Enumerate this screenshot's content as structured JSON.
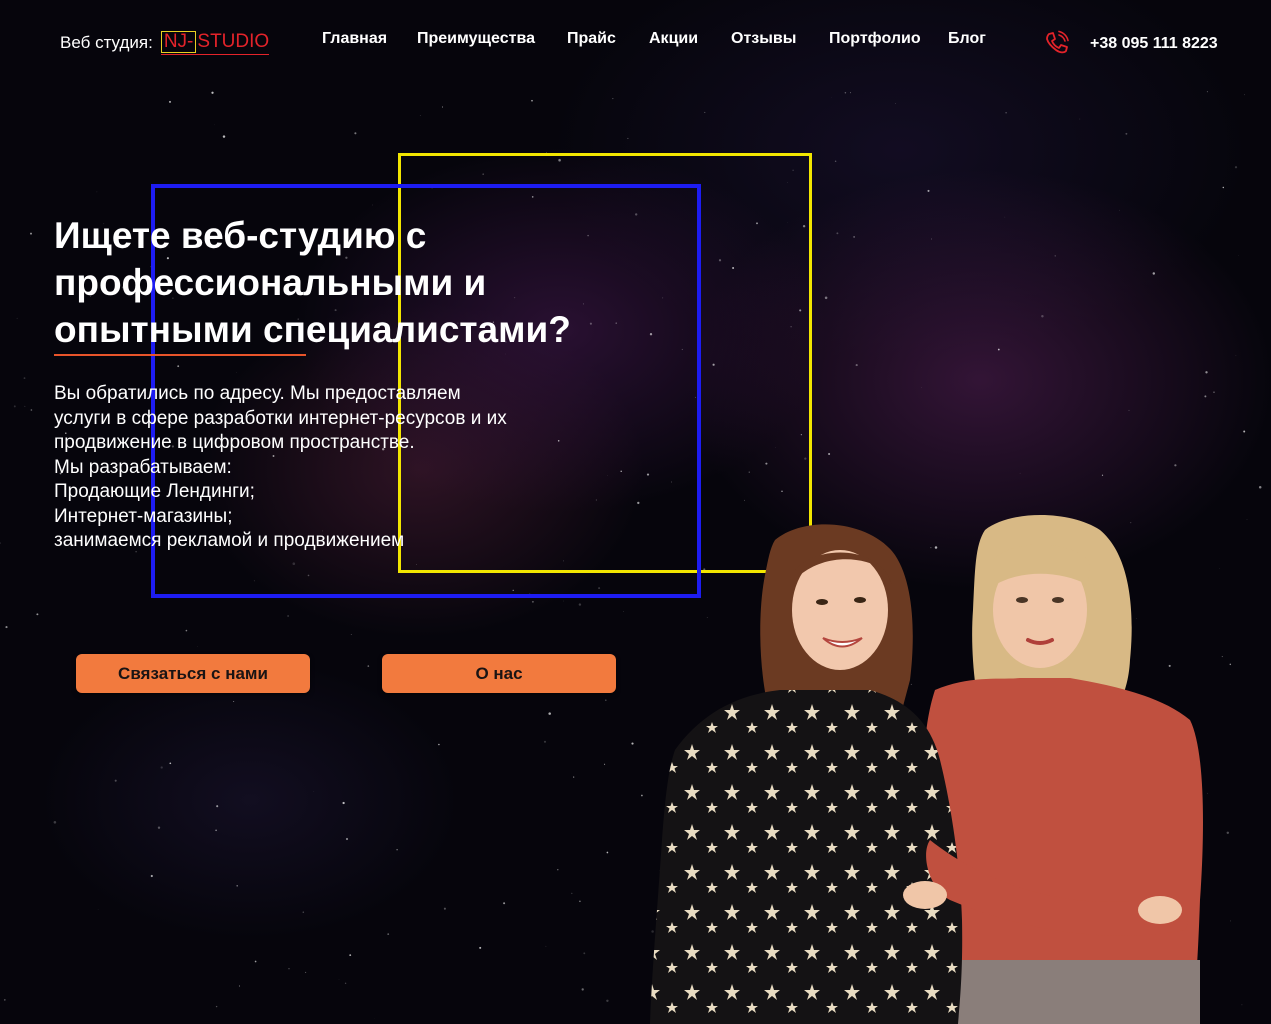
{
  "header": {
    "logo_prefix": "Веб студия:",
    "logo_nj": "NJ-",
    "logo_studio": "STUDIO",
    "nav": [
      {
        "label": "Главная"
      },
      {
        "label": "Преимущества"
      },
      {
        "label": "Прайс"
      },
      {
        "label": "Акции"
      },
      {
        "label": "Отзывы"
      },
      {
        "label": "Портфолио"
      },
      {
        "label": "Блог"
      }
    ],
    "phone": "+38 095 111 8223"
  },
  "hero": {
    "title": "Ищете веб-студию с профессиональными и опытными специалистами?",
    "description": "Вы обратились по адресу. Мы предоставляем\nуслуги в сфере разработки интернет-ресурсов и их\nпродвижение в цифровом пространстве.\nМы разрабатываем:\nПродающие Лендинги;\nИнтернет-магазины;\nзанимаемся рекламой и продвижением",
    "contact_button": "Связаться с нами",
    "about_button": "О нас"
  },
  "colors": {
    "accent": "#f27a3e",
    "frame_yellow": "#f2e600",
    "frame_blue": "#1d1cf2",
    "logo_red": "#e3232a"
  }
}
